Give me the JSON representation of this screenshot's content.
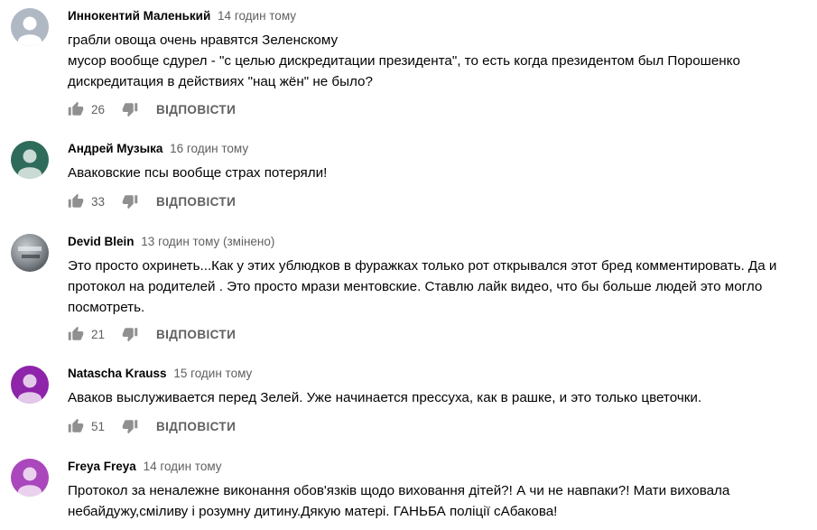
{
  "comments": [
    {
      "author": "Иннокентий Маленький",
      "time": "14 годин тому",
      "text": "грабли овоща очень нравятся Зеленскому\nмусор вообще сдурел - \"с целью дискредитации президента\", то есть когда президентом был Порошенко\nдискредитация в действиях \"нац жён\" не было?",
      "likes": "26",
      "reply_label": "ВІДПОВІСТИ",
      "avatar_color": "#b0b8c4"
    },
    {
      "author": "Андрей Музыка",
      "time": "16 годин тому",
      "text": "Аваковские псы вообще страх потеряли!",
      "likes": "33",
      "reply_label": "ВІДПОВІСТИ",
      "avatar_color": "#2e6b5a"
    },
    {
      "author": "Devid Blein",
      "time": "13 годин тому (змінено)",
      "text": "Это просто охринеть...Как у этих ублюдков  в фуражках  только рот открывался этот бред комментировать. Да и\nпротокол на родителей . Это просто мрази ментовские. Ставлю лайк видео, что бы больше людей это могло\nпосмотреть.",
      "likes": "21",
      "reply_label": "ВІДПОВІСТИ",
      "avatar_color": "#8a9096"
    },
    {
      "author": "Natascha Krauss",
      "time": "15 годин тому",
      "text": "Аваков выслуживается перед Зелей. Уже начинается прессуха, как в рашке, и это только цветочки.",
      "likes": "51",
      "reply_label": "ВІДПОВІСТИ",
      "avatar_color": "#8e24aa"
    },
    {
      "author": "Freya Freya",
      "time": "14 годин тому",
      "text": "Протокол за неналежне  виконання обов'язків щодо виховання дітей?! А чи не навпаки?! Мати виховала\nнебайдужу,сміливу і розумну дитину.Дякую матері. ГАНЬБА  поліції сАбакова!",
      "likes": "",
      "reply_label": "",
      "avatar_color": "#ab47bc"
    }
  ],
  "colors": {
    "text_primary": "#030303",
    "text_secondary": "#606060",
    "icon": "#909090"
  }
}
